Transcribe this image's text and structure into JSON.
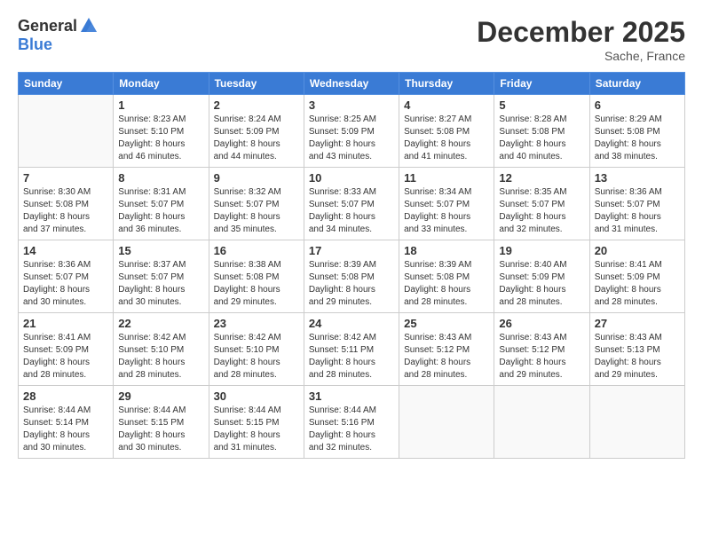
{
  "header": {
    "logo_general": "General",
    "logo_blue": "Blue",
    "month_title": "December 2025",
    "location": "Sache, France"
  },
  "days_of_week": [
    "Sunday",
    "Monday",
    "Tuesday",
    "Wednesday",
    "Thursday",
    "Friday",
    "Saturday"
  ],
  "weeks": [
    [
      {
        "day": "",
        "info": ""
      },
      {
        "day": "1",
        "info": "Sunrise: 8:23 AM\nSunset: 5:10 PM\nDaylight: 8 hours\nand 46 minutes."
      },
      {
        "day": "2",
        "info": "Sunrise: 8:24 AM\nSunset: 5:09 PM\nDaylight: 8 hours\nand 44 minutes."
      },
      {
        "day": "3",
        "info": "Sunrise: 8:25 AM\nSunset: 5:09 PM\nDaylight: 8 hours\nand 43 minutes."
      },
      {
        "day": "4",
        "info": "Sunrise: 8:27 AM\nSunset: 5:08 PM\nDaylight: 8 hours\nand 41 minutes."
      },
      {
        "day": "5",
        "info": "Sunrise: 8:28 AM\nSunset: 5:08 PM\nDaylight: 8 hours\nand 40 minutes."
      },
      {
        "day": "6",
        "info": "Sunrise: 8:29 AM\nSunset: 5:08 PM\nDaylight: 8 hours\nand 38 minutes."
      }
    ],
    [
      {
        "day": "7",
        "info": "Sunrise: 8:30 AM\nSunset: 5:08 PM\nDaylight: 8 hours\nand 37 minutes."
      },
      {
        "day": "8",
        "info": "Sunrise: 8:31 AM\nSunset: 5:07 PM\nDaylight: 8 hours\nand 36 minutes."
      },
      {
        "day": "9",
        "info": "Sunrise: 8:32 AM\nSunset: 5:07 PM\nDaylight: 8 hours\nand 35 minutes."
      },
      {
        "day": "10",
        "info": "Sunrise: 8:33 AM\nSunset: 5:07 PM\nDaylight: 8 hours\nand 34 minutes."
      },
      {
        "day": "11",
        "info": "Sunrise: 8:34 AM\nSunset: 5:07 PM\nDaylight: 8 hours\nand 33 minutes."
      },
      {
        "day": "12",
        "info": "Sunrise: 8:35 AM\nSunset: 5:07 PM\nDaylight: 8 hours\nand 32 minutes."
      },
      {
        "day": "13",
        "info": "Sunrise: 8:36 AM\nSunset: 5:07 PM\nDaylight: 8 hours\nand 31 minutes."
      }
    ],
    [
      {
        "day": "14",
        "info": "Sunrise: 8:36 AM\nSunset: 5:07 PM\nDaylight: 8 hours\nand 30 minutes."
      },
      {
        "day": "15",
        "info": "Sunrise: 8:37 AM\nSunset: 5:07 PM\nDaylight: 8 hours\nand 30 minutes."
      },
      {
        "day": "16",
        "info": "Sunrise: 8:38 AM\nSunset: 5:08 PM\nDaylight: 8 hours\nand 29 minutes."
      },
      {
        "day": "17",
        "info": "Sunrise: 8:39 AM\nSunset: 5:08 PM\nDaylight: 8 hours\nand 29 minutes."
      },
      {
        "day": "18",
        "info": "Sunrise: 8:39 AM\nSunset: 5:08 PM\nDaylight: 8 hours\nand 28 minutes."
      },
      {
        "day": "19",
        "info": "Sunrise: 8:40 AM\nSunset: 5:09 PM\nDaylight: 8 hours\nand 28 minutes."
      },
      {
        "day": "20",
        "info": "Sunrise: 8:41 AM\nSunset: 5:09 PM\nDaylight: 8 hours\nand 28 minutes."
      }
    ],
    [
      {
        "day": "21",
        "info": "Sunrise: 8:41 AM\nSunset: 5:09 PM\nDaylight: 8 hours\nand 28 minutes."
      },
      {
        "day": "22",
        "info": "Sunrise: 8:42 AM\nSunset: 5:10 PM\nDaylight: 8 hours\nand 28 minutes."
      },
      {
        "day": "23",
        "info": "Sunrise: 8:42 AM\nSunset: 5:10 PM\nDaylight: 8 hours\nand 28 minutes."
      },
      {
        "day": "24",
        "info": "Sunrise: 8:42 AM\nSunset: 5:11 PM\nDaylight: 8 hours\nand 28 minutes."
      },
      {
        "day": "25",
        "info": "Sunrise: 8:43 AM\nSunset: 5:12 PM\nDaylight: 8 hours\nand 28 minutes."
      },
      {
        "day": "26",
        "info": "Sunrise: 8:43 AM\nSunset: 5:12 PM\nDaylight: 8 hours\nand 29 minutes."
      },
      {
        "day": "27",
        "info": "Sunrise: 8:43 AM\nSunset: 5:13 PM\nDaylight: 8 hours\nand 29 minutes."
      }
    ],
    [
      {
        "day": "28",
        "info": "Sunrise: 8:44 AM\nSunset: 5:14 PM\nDaylight: 8 hours\nand 30 minutes."
      },
      {
        "day": "29",
        "info": "Sunrise: 8:44 AM\nSunset: 5:15 PM\nDaylight: 8 hours\nand 30 minutes."
      },
      {
        "day": "30",
        "info": "Sunrise: 8:44 AM\nSunset: 5:15 PM\nDaylight: 8 hours\nand 31 minutes."
      },
      {
        "day": "31",
        "info": "Sunrise: 8:44 AM\nSunset: 5:16 PM\nDaylight: 8 hours\nand 32 minutes."
      },
      {
        "day": "",
        "info": ""
      },
      {
        "day": "",
        "info": ""
      },
      {
        "day": "",
        "info": ""
      }
    ]
  ]
}
